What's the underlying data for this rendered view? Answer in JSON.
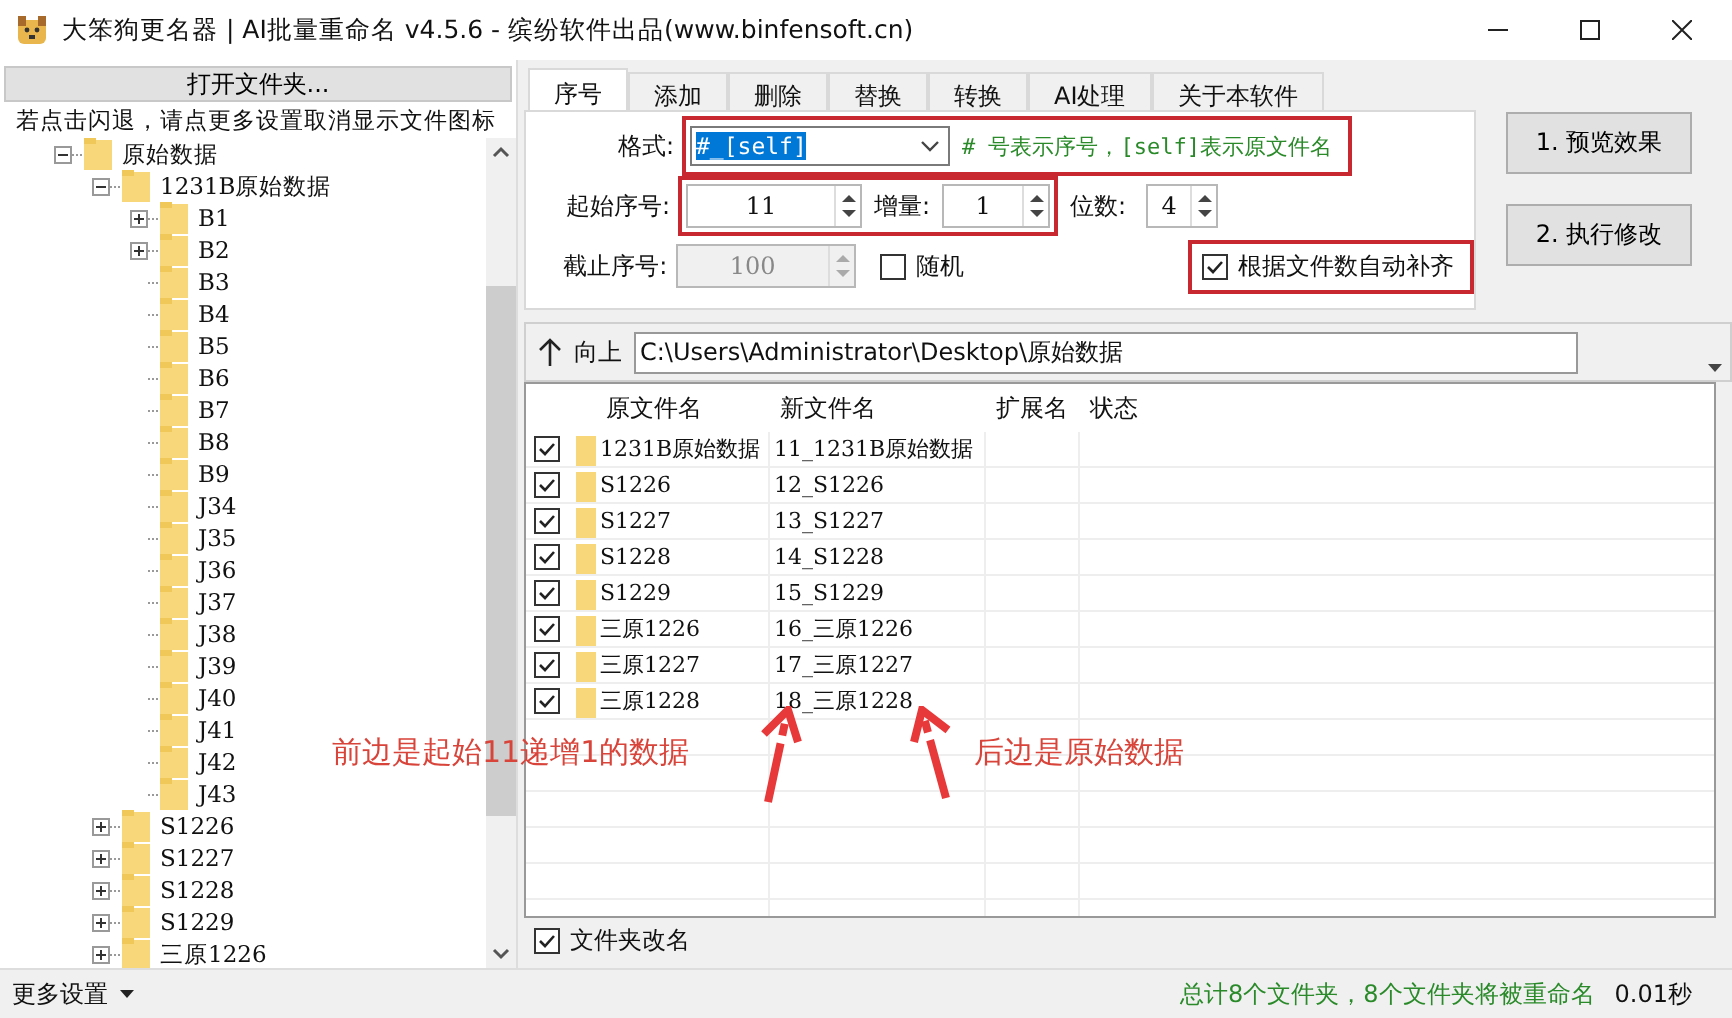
{
  "window": {
    "title": "大笨狗更名器 | AI批量重命名 v4.5.6 - 缤纷软件出品(www.binfensoft.cn)"
  },
  "left_panel": {
    "open_button": "打开文件夹...",
    "hint": "若点击闪退，请点更多设置取消显示文件图标",
    "tree": [
      {
        "label": "原始数据",
        "expanded": true,
        "children": [
          {
            "label": "1231B原始数据",
            "expanded": true,
            "children": [
              {
                "label": "B1",
                "expanded": false
              },
              {
                "label": "B2",
                "expanded": false
              },
              {
                "label": "B3"
              },
              {
                "label": "B4"
              },
              {
                "label": "B5"
              },
              {
                "label": "B6"
              },
              {
                "label": "B7"
              },
              {
                "label": "B8"
              },
              {
                "label": "B9"
              },
              {
                "label": "J34"
              },
              {
                "label": "J35"
              },
              {
                "label": "J36"
              },
              {
                "label": "J37"
              },
              {
                "label": "J38"
              },
              {
                "label": "J39"
              },
              {
                "label": "J40"
              },
              {
                "label": "J41"
              },
              {
                "label": "J42"
              },
              {
                "label": "J43"
              }
            ]
          },
          {
            "label": "S1226",
            "expanded": false
          },
          {
            "label": "S1227",
            "expanded": false
          },
          {
            "label": "S1228",
            "expanded": false
          },
          {
            "label": "S1229",
            "expanded": false
          },
          {
            "label": "三原1226",
            "expanded": false
          }
        ]
      }
    ]
  },
  "tabs": [
    {
      "label": "序号",
      "selected": true
    },
    {
      "label": "添加",
      "selected": false
    },
    {
      "label": "删除",
      "selected": false
    },
    {
      "label": "替换",
      "selected": false
    },
    {
      "label": "转换",
      "selected": false
    },
    {
      "label": "AI处理",
      "selected": false
    },
    {
      "label": "关于本软件",
      "selected": false
    }
  ],
  "settings": {
    "format_label": "格式:",
    "format_value": "#_[self]",
    "format_hint": "# 号表示序号，[self]表示原文件名",
    "start_label": "起始序号:",
    "start_value": "11",
    "step_label": "增量:",
    "step_value": "1",
    "digits_label": "位数:",
    "digits_value": "4",
    "end_label": "截止序号:",
    "end_value": "100",
    "end_disabled": true,
    "random": {
      "label": "随机",
      "checked": false
    },
    "auto_pad": {
      "label": "根据文件数自动补齐",
      "checked": true
    }
  },
  "action_buttons": [
    "1. 预览效果",
    "2. 执行修改"
  ],
  "path_bar": {
    "up_label": "向上",
    "path": "C:\\Users\\Administrator\\Desktop\\原始数据"
  },
  "table": {
    "columns": [
      "原文件名",
      "新文件名",
      "扩展名",
      "状态"
    ],
    "rows": [
      {
        "checked": true,
        "original": "1231B原始数据",
        "new": "11_1231B原始数据"
      },
      {
        "checked": true,
        "original": "S1226",
        "new": "12_S1226"
      },
      {
        "checked": true,
        "original": "S1227",
        "new": "13_S1227"
      },
      {
        "checked": true,
        "original": "S1228",
        "new": "14_S1228"
      },
      {
        "checked": true,
        "original": "S1229",
        "new": "15_S1229"
      },
      {
        "checked": true,
        "original": "三原1226",
        "new": "16_三原1226"
      },
      {
        "checked": true,
        "original": "三原1227",
        "new": "17_三原1227"
      },
      {
        "checked": true,
        "original": "三原1228",
        "new": "18_三原1228"
      }
    ]
  },
  "folder_rename": {
    "label": "文件夹改名",
    "checked": true
  },
  "more_settings": "更多设置",
  "status_bar": {
    "summary": "总计8个文件夹，8个文件夹将被重命名",
    "time": "0.01秒"
  },
  "annotations": [
    {
      "text": "前边是起始11递增1的数据"
    },
    {
      "text": "后边是原始数据"
    }
  ]
}
